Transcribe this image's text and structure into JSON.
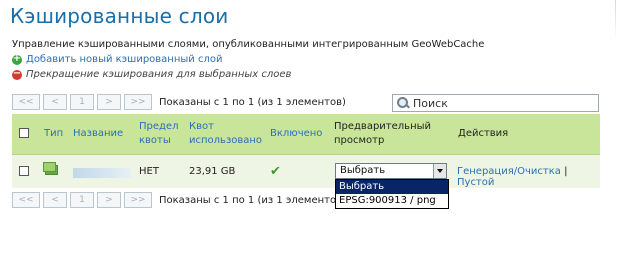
{
  "page": {
    "title": "Кэшированные слои",
    "description": "Управление кэшированными слоями, опубликованными интегрированным GeoWebCache",
    "add_link": "Добавить новый кэшированный слой",
    "stop_link": "Прекращение кэширования для выбранных слоев"
  },
  "pager": {
    "first": "<<",
    "prev": "<",
    "page": "1",
    "next": ">",
    "last": ">>",
    "info": "Показаны с 1 по 1 (из 1 элементов)"
  },
  "search": {
    "placeholder": "Поиск"
  },
  "table": {
    "headers": {
      "type": "Тип",
      "name": "Название",
      "quota_limit_l1": "Предел",
      "quota_limit_l2": "квоты",
      "quota_used_l1": "Квот",
      "quota_used_l2": "использовано",
      "enabled": "Включено",
      "preview_l1": "Предварительный",
      "preview_l2": "просмотр",
      "actions": "Действия"
    },
    "rows": [
      {
        "quota_limit": "НЕТ",
        "quota_used": "23,91 GB",
        "enabled_mark": "✔",
        "preview_selected": "Выбрать",
        "action_generate": "Генерация/Очистка",
        "action_sep": "|",
        "action_empty": "Пустой"
      }
    ]
  },
  "dropdown": {
    "options": [
      "Выбрать",
      "EPSG:900913 / png"
    ]
  },
  "colors": {
    "title": "#1a6fa8",
    "link": "#2b6fb6",
    "header_bg": "#c9e59a",
    "row_bg": "#eef5e4",
    "selected_option_bg": "#0a246a"
  },
  "icons": {
    "add": "add-circle-icon",
    "stop": "stop-circle-icon",
    "search": "search-icon",
    "layer_type": "layer-icon",
    "enabled": "checkmark-icon",
    "select_arrow": "chevron-down-icon"
  }
}
